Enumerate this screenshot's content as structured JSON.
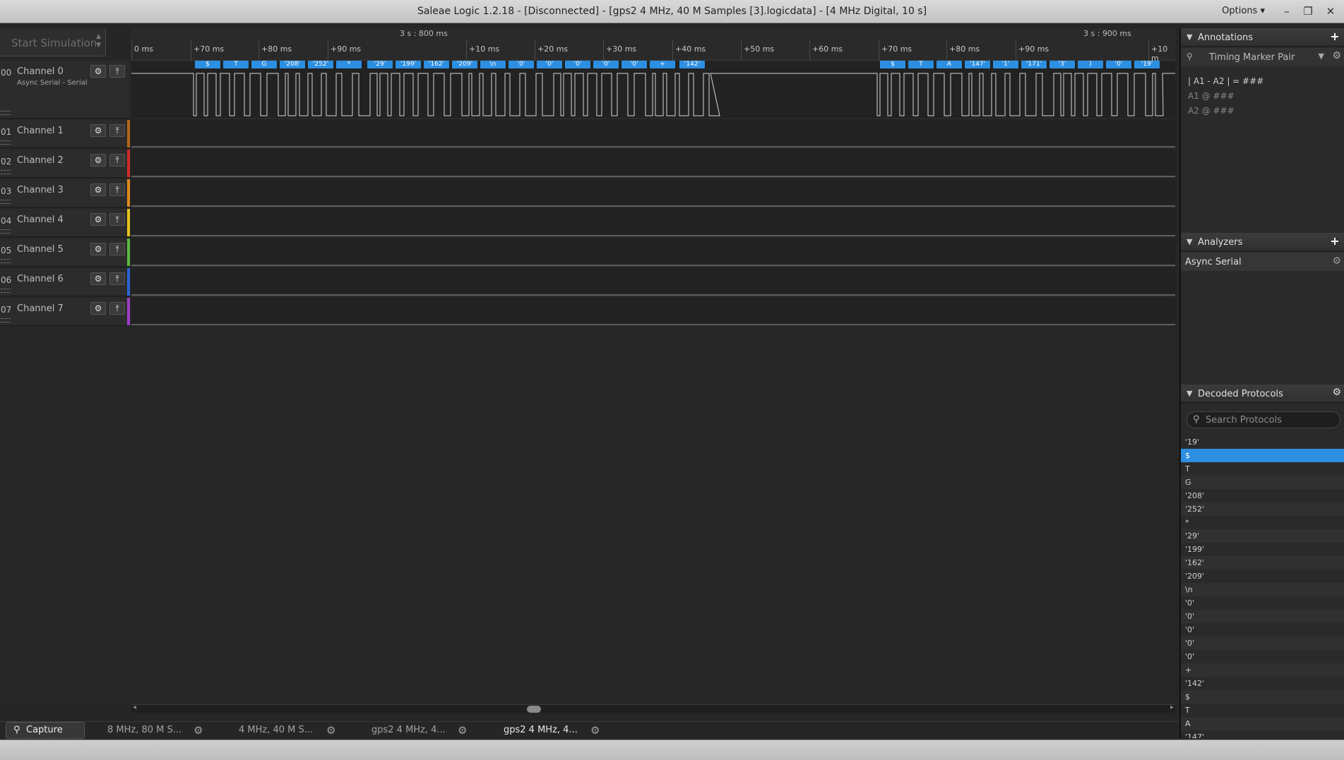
{
  "window": {
    "title": "Saleae Logic 1.2.18 - [Disconnected] - [gps2 4 MHz, 40 M Samples [3].logicdata] - [4 MHz Digital, 10 s]",
    "options": "Options ▾",
    "minimize": "–",
    "maximize": "❐",
    "close": "✕"
  },
  "simulation": {
    "label": "Start Simulation"
  },
  "ruler": {
    "major": [
      "3 s : 800 ms",
      "3 s : 900 ms"
    ],
    "minor": [
      "0 ms",
      "+70 ms",
      "+80 ms",
      "+90 ms",
      "+10 ms",
      "+20 ms",
      "+30 ms",
      "+40 ms",
      "+50 ms",
      "+60 ms",
      "+70 ms",
      "+80 ms",
      "+90 ms",
      "+10 m"
    ]
  },
  "channels": [
    {
      "num": "00",
      "name": "Channel 0",
      "sub": "Async Serial - Serial",
      "color": "#2a2a2a"
    },
    {
      "num": "01",
      "name": "Channel 1",
      "sub": "",
      "color": "#b5651d"
    },
    {
      "num": "02",
      "name": "Channel 2",
      "sub": "",
      "color": "#d42a2a"
    },
    {
      "num": "03",
      "name": "Channel 3",
      "sub": "",
      "color": "#e08a1e"
    },
    {
      "num": "04",
      "name": "Channel 4",
      "sub": "",
      "color": "#e6c31e"
    },
    {
      "num": "05",
      "name": "Channel 5",
      "sub": "",
      "color": "#5cb83c"
    },
    {
      "num": "06",
      "name": "Channel 6",
      "sub": "",
      "color": "#2b63d4"
    },
    {
      "num": "07",
      "name": "Channel 7",
      "sub": "",
      "color": "#9b3fc8"
    }
  ],
  "decoded_bar": [
    "$",
    "T",
    "G",
    "'208'",
    "'252'",
    "*",
    "'29'",
    "'199'",
    "'162'",
    "'209'",
    "\\n",
    "'0'",
    "'0'",
    "'0'",
    "'0'",
    "'0'",
    "+",
    "'142'",
    "$",
    "T",
    "A",
    "'147'",
    "'1'",
    "'171'",
    "'3'",
    ")",
    "'0'",
    "'19'"
  ],
  "tabs": {
    "capture": "Capture",
    "items": [
      "8 MHz, 80 M S...",
      "4 MHz, 40 M S...",
      "gps2 4 MHz, 4...",
      "gps2 4 MHz, 4..."
    ]
  },
  "annotations": {
    "header": "Annotations",
    "timing_marker": "Timing Marker Pair",
    "formula": "| A1 - A2 | = ###",
    "a1": "A1  @  ###",
    "a2": "A2  @  ###"
  },
  "analyzers": {
    "header": "Analyzers",
    "item": "Async Serial"
  },
  "decoded_protocols": {
    "header": "Decoded Protocols",
    "search_placeholder": "Search Protocols",
    "rows": [
      "'19'",
      "$",
      "T",
      "G",
      "'208'",
      "'252'",
      "*",
      "'29'",
      "'199'",
      "'162'",
      "'209'",
      "\\n",
      "'0'",
      "'0'",
      "'0'",
      "'0'",
      "'0'",
      "+",
      "'142'",
      "$",
      "T",
      "A",
      "'147'"
    ]
  },
  "icons": {
    "gear": "gear-icon",
    "trigger": "trigger-icon",
    "search": "search-icon",
    "pin": "pin-icon"
  }
}
